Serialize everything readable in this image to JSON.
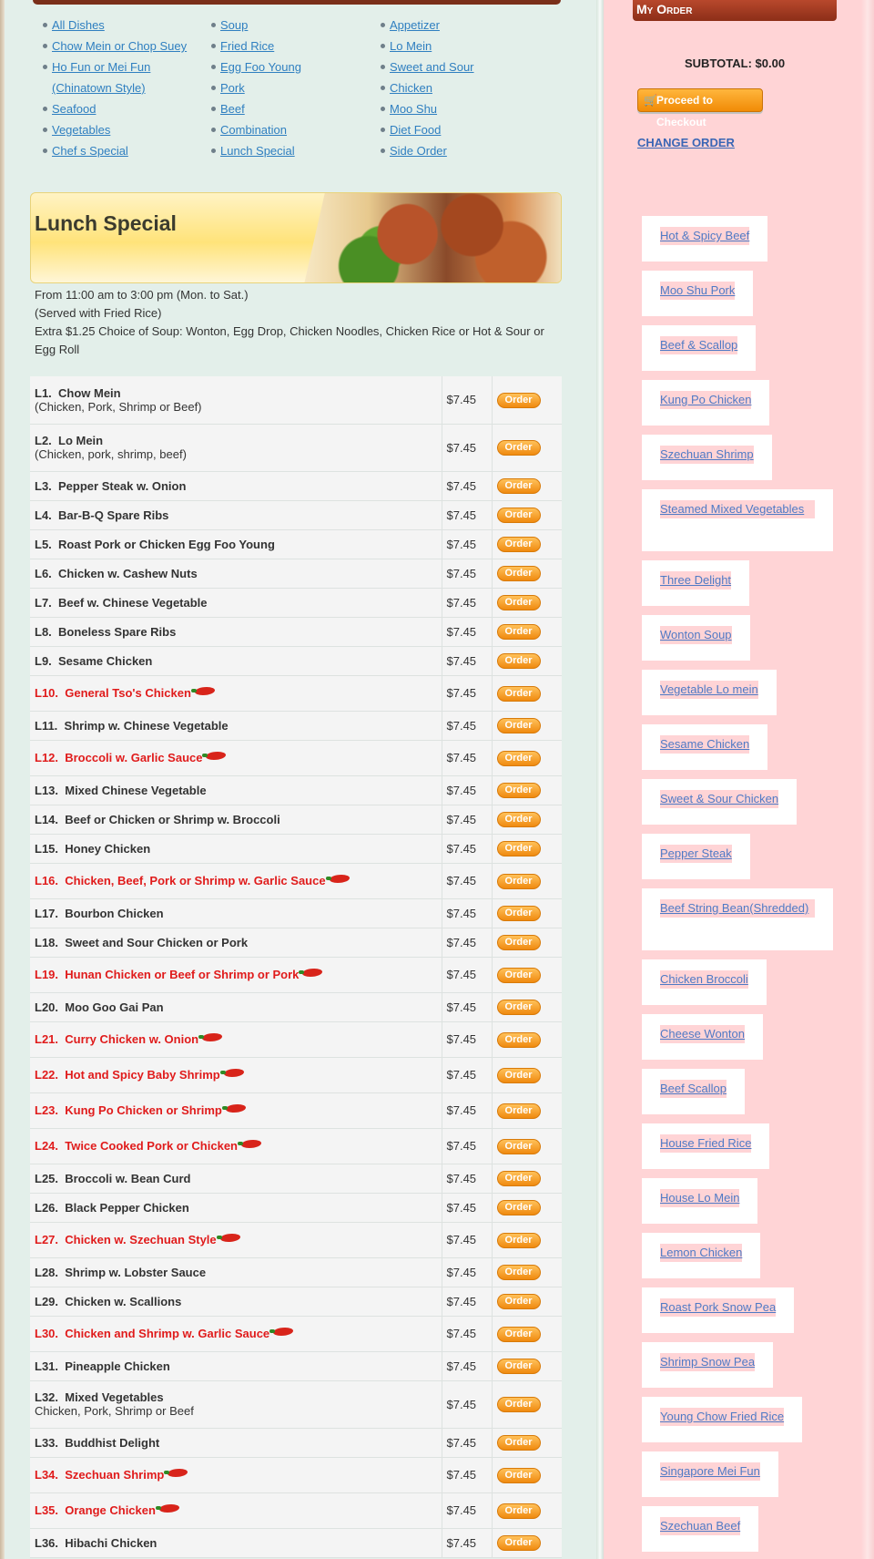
{
  "categories": {
    "col1": [
      "All Dishes",
      "Chow Mein or Chop Suey",
      "Ho Fun or Mei Fun (Chinatown Style)",
      "Seafood",
      "Vegetables",
      "Chef s Special"
    ],
    "col2": [
      "Soup",
      "Fried Rice",
      "Egg Foo Young",
      "Pork",
      "Beef",
      "Combination",
      "Lunch Special"
    ],
    "col3": [
      "Appetizer",
      "Lo Mein",
      "Sweet and Sour",
      "Chicken",
      "Moo Shu",
      "Diet Food",
      "Side Order"
    ]
  },
  "banner": {
    "title": "Lunch Special"
  },
  "intro": {
    "line1": "From 11:00 am to 3:00 pm (Mon. to Sat.)",
    "line2": "(Served with Fried Rice)",
    "line3": "Extra $1.25 Choice of Soup: Wonton, Egg Drop, Chicken Noodles, Chicken Rice or Hot & Sour or Egg Roll"
  },
  "order_label": "Order",
  "menu": [
    {
      "code": "L1.",
      "name": "Chow Mein",
      "desc": "(Chicken, Pork, Shrimp or Beef)",
      "price": "$7.45",
      "hot": false
    },
    {
      "code": "L2.",
      "name": "Lo Mein",
      "desc": "(Chicken, pork, shrimp, beef)",
      "price": "$7.45",
      "hot": false
    },
    {
      "code": "L3.",
      "name": "Pepper Steak w. Onion",
      "desc": "",
      "price": "$7.45",
      "hot": false
    },
    {
      "code": "L4.",
      "name": "Bar-B-Q Spare Ribs",
      "desc": "",
      "price": "$7.45",
      "hot": false
    },
    {
      "code": "L5.",
      "name": "Roast Pork or Chicken Egg Foo Young",
      "desc": "",
      "price": "$7.45",
      "hot": false
    },
    {
      "code": "L6.",
      "name": "Chicken w. Cashew Nuts",
      "desc": "",
      "price": "$7.45",
      "hot": false
    },
    {
      "code": "L7.",
      "name": "Beef w. Chinese Vegetable",
      "desc": "",
      "price": "$7.45",
      "hot": false
    },
    {
      "code": "L8.",
      "name": "Boneless Spare Ribs",
      "desc": "",
      "price": "$7.45",
      "hot": false
    },
    {
      "code": "L9.",
      "name": "Sesame Chicken",
      "desc": "",
      "price": "$7.45",
      "hot": false
    },
    {
      "code": "L10.",
      "name": "General Tso's Chicken",
      "desc": "",
      "price": "$7.45",
      "hot": true
    },
    {
      "code": "L11.",
      "name": "Shrimp w. Chinese Vegetable",
      "desc": "",
      "price": "$7.45",
      "hot": false
    },
    {
      "code": "L12.",
      "name": "Broccoli w. Garlic Sauce",
      "desc": "",
      "price": "$7.45",
      "hot": true
    },
    {
      "code": "L13.",
      "name": "Mixed Chinese Vegetable",
      "desc": "",
      "price": "$7.45",
      "hot": false
    },
    {
      "code": "L14.",
      "name": "Beef or Chicken or Shrimp w. Broccoli",
      "desc": "",
      "price": "$7.45",
      "hot": false
    },
    {
      "code": "L15.",
      "name": "Honey Chicken",
      "desc": "",
      "price": "$7.45",
      "hot": false
    },
    {
      "code": "L16.",
      "name": "Chicken, Beef, Pork or Shrimp w. Garlic Sauce",
      "desc": "",
      "price": "$7.45",
      "hot": true
    },
    {
      "code": "L17.",
      "name": "Bourbon Chicken",
      "desc": "",
      "price": "$7.45",
      "hot": false
    },
    {
      "code": "L18.",
      "name": "Sweet and Sour Chicken or Pork",
      "desc": "",
      "price": "$7.45",
      "hot": false
    },
    {
      "code": "L19.",
      "name": "Hunan Chicken or Beef or Shrimp or Pork",
      "desc": "",
      "price": "$7.45",
      "hot": true
    },
    {
      "code": "L20.",
      "name": "Moo Goo Gai Pan",
      "desc": "",
      "price": "$7.45",
      "hot": false
    },
    {
      "code": "L21.",
      "name": "Curry Chicken w. Onion",
      "desc": "",
      "price": "$7.45",
      "hot": true
    },
    {
      "code": "L22.",
      "name": "Hot and Spicy Baby Shrimp",
      "desc": "",
      "price": "$7.45",
      "hot": true
    },
    {
      "code": "L23.",
      "name": "Kung Po Chicken or Shrimp",
      "desc": "",
      "price": "$7.45",
      "hot": true
    },
    {
      "code": "L24.",
      "name": "Twice Cooked Pork or Chicken",
      "desc": "",
      "price": "$7.45",
      "hot": true
    },
    {
      "code": "L25.",
      "name": "Broccoli w. Bean Curd",
      "desc": "",
      "price": "$7.45",
      "hot": false
    },
    {
      "code": "L26.",
      "name": "Black Pepper Chicken",
      "desc": "",
      "price": "$7.45",
      "hot": false
    },
    {
      "code": "L27.",
      "name": "Chicken w. Szechuan Style",
      "desc": "",
      "price": "$7.45",
      "hot": true
    },
    {
      "code": "L28.",
      "name": "Shrimp w. Lobster Sauce",
      "desc": "",
      "price": "$7.45",
      "hot": false
    },
    {
      "code": "L29.",
      "name": "Chicken w. Scallions",
      "desc": "",
      "price": "$7.45",
      "hot": false
    },
    {
      "code": "L30.",
      "name": "Chicken and Shrimp w. Garlic Sauce",
      "desc": "",
      "price": "$7.45",
      "hot": true
    },
    {
      "code": "L31.",
      "name": "Pineapple Chicken",
      "desc": "",
      "price": "$7.45",
      "hot": false
    },
    {
      "code": "L32.",
      "name": "Mixed Vegetables",
      "desc": "Chicken, Pork, Shrimp or Beef",
      "price": "$7.45",
      "hot": false
    },
    {
      "code": "L33.",
      "name": "Buddhist Delight",
      "desc": "",
      "price": "$7.45",
      "hot": false
    },
    {
      "code": "L34.",
      "name": "Szechuan Shrimp",
      "desc": "",
      "price": "$7.45",
      "hot": true
    },
    {
      "code": "L35.",
      "name": "Orange Chicken",
      "desc": "",
      "price": "$7.45",
      "hot": true
    },
    {
      "code": "L36.",
      "name": "Hibachi Chicken",
      "desc": "",
      "price": "$7.45",
      "hot": false
    }
  ],
  "sidebar": {
    "title": "My Order",
    "subtotal": "SUBTOTAL: $0.00",
    "checkout": "Proceed to Checkout",
    "change_order": "CHANGE ORDER",
    "featured": [
      "Hot & Spicy Beef",
      "Moo Shu Pork",
      "Beef & Scallop",
      "Kung Po Chicken",
      "Szechuan Shrimp",
      "Steamed Mixed Vegetables",
      "Three Delight",
      "Wonton Soup",
      "Vegetable Lo mein",
      "Sesame Chicken",
      "Sweet & Sour Chicken",
      "Pepper Steak",
      "Beef String Bean(Shredded)",
      "Chicken Broccoli",
      "Cheese Wonton",
      "Beef Scallop",
      "House Fried Rice",
      "House Lo Mein",
      "Lemon Chicken",
      "Roast Pork Snow Pea",
      "Shrimp Snow Pea",
      "Young Chow Fried Rice",
      "Singapore Mei Fun",
      "Szechuan Beef"
    ]
  },
  "colors": {
    "hot_text": "#e01b1b",
    "link": "#2f7fc0",
    "sidebar_bg": "#ffd4d6",
    "accent": "#f08a10"
  }
}
